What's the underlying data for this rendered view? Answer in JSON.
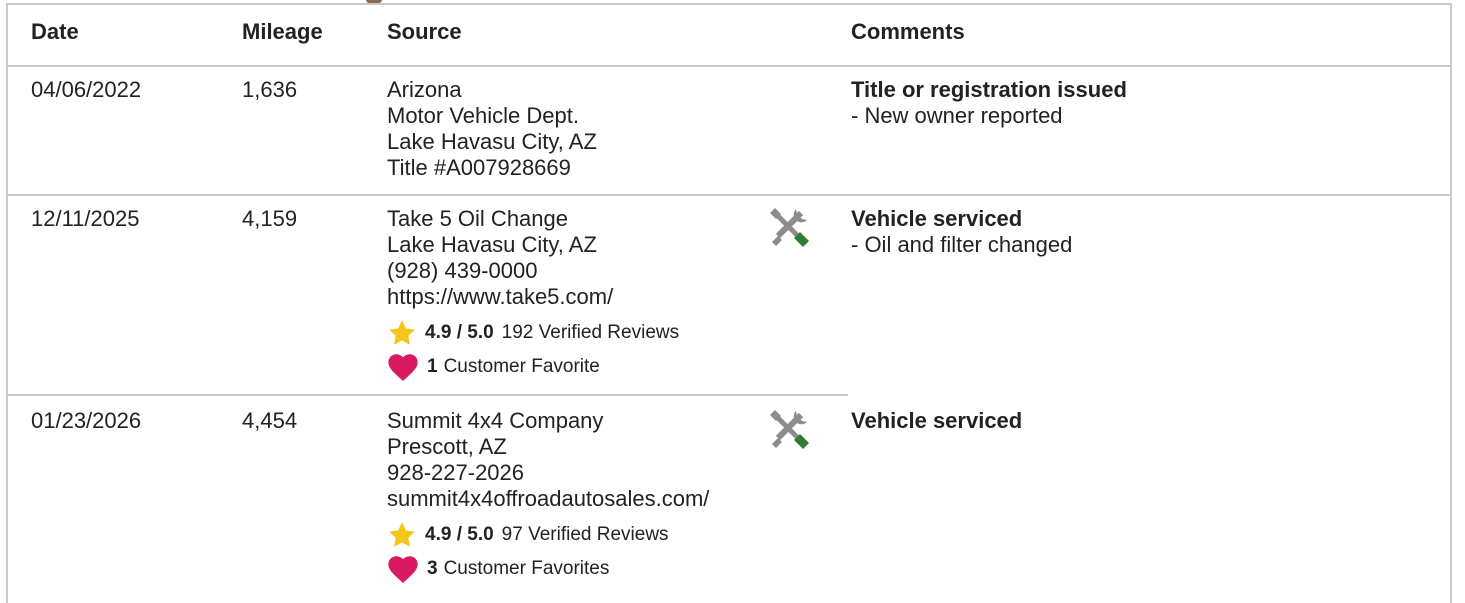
{
  "header": {
    "date": "Date",
    "mileage": "Mileage",
    "source": "Source",
    "comments": "Comments"
  },
  "rows": [
    {
      "date": "04/06/2022",
      "mileage": "1,636",
      "source": [
        "Arizona",
        "Motor Vehicle Dept.",
        "Lake Havasu City, AZ",
        "Title #A007928669"
      ],
      "comment_title": "Title or registration issued",
      "comment_detail": "- New owner reported"
    },
    {
      "date": "12/11/2025",
      "mileage": "4,159",
      "source": [
        "Take 5 Oil Change",
        "Lake Havasu City, AZ",
        "(928) 439-0000",
        "https://www.take5.com/"
      ],
      "icon": "service-wrench-screwdriver-icon",
      "rating": "4.9 / 5.0",
      "reviews": "192 Verified Reviews",
      "favorites_count": "1",
      "favorites_label": "Customer Favorite",
      "comment_title": "Vehicle serviced",
      "comment_detail": "- Oil and filter changed"
    },
    {
      "date": "01/23/2026",
      "mileage": "4,454",
      "source": [
        "Summit 4x4 Company",
        "Prescott, AZ",
        "928-227-2026",
        "summit4x4offroadautosales.com/"
      ],
      "icon": "service-wrench-screwdriver-icon",
      "rating": "4.9 / 5.0",
      "reviews": "97 Verified Reviews",
      "favorites_count": "3",
      "favorites_label": "Customer Favorites",
      "comment_title": "Vehicle serviced"
    }
  ],
  "colors": {
    "border": "#c9c9c9",
    "star": "#f5c518",
    "heart": "#d81b60",
    "wrench": "#8c8c8c",
    "screwdriver": "#2e7d32"
  }
}
